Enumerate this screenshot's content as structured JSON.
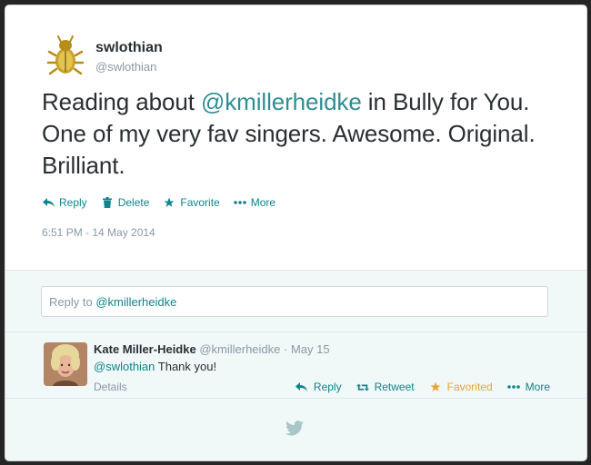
{
  "tweet": {
    "name": "swlothian",
    "handle": "@swlothian",
    "text_prefix": "Reading about ",
    "text_mention": "@kmillerheidke",
    "text_suffix": " in Bully for You. One of my very fav singers. Awesome. Original. Brilliant.",
    "actions": {
      "reply": "Reply",
      "delete": "Delete",
      "favorite": "Favorite",
      "more": "More"
    },
    "timestamp": "6:51 PM - 14 May 2014"
  },
  "reply_box": {
    "prefix": "Reply to ",
    "mention": "@kmillerheidke"
  },
  "reply": {
    "name": "Kate Miller-Heidke",
    "handle_date": "@kmillerheidke · May 15",
    "mention": "@swlothian",
    "text": " Thank you!",
    "details": "Details",
    "actions": {
      "reply": "Reply",
      "retweet": "Retweet",
      "favorited": "Favorited",
      "more": "More"
    }
  },
  "colors": {
    "accent": "#0f848c",
    "favorited": "#e8a434",
    "meta": "#8899a6",
    "background": "#252525"
  },
  "icons": [
    "scarab-avatar",
    "reply-icon",
    "trash-icon",
    "star-icon",
    "more-icon",
    "retweet-icon",
    "twitter-bird-icon"
  ]
}
